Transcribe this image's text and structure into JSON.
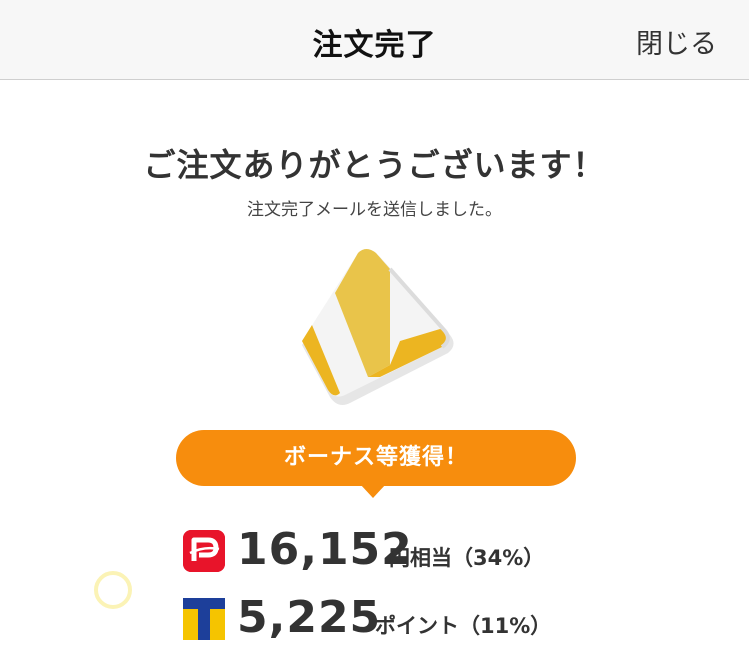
{
  "header": {
    "title": "注文完了",
    "close_label": "閉じる"
  },
  "main": {
    "heading": "ご注文ありがとうございます！",
    "subheading": "注文完了メールを送信しました。",
    "bonus_banner": "ボーナス等獲得！",
    "rewards": [
      {
        "icon": "paypay-logo-icon",
        "amount": "16,152",
        "unit": "円相当（34%）"
      },
      {
        "icon": "t-point-logo-icon",
        "amount": "5,225",
        "unit": "ポイント（11%）"
      }
    ]
  },
  "colors": {
    "accent_orange": "#f78d0d",
    "paypay_red": "#e8142a",
    "tpoint_blue": "#1d3f9a",
    "tpoint_yellow": "#f5c400",
    "cracker_yellow": "#ecb521"
  }
}
